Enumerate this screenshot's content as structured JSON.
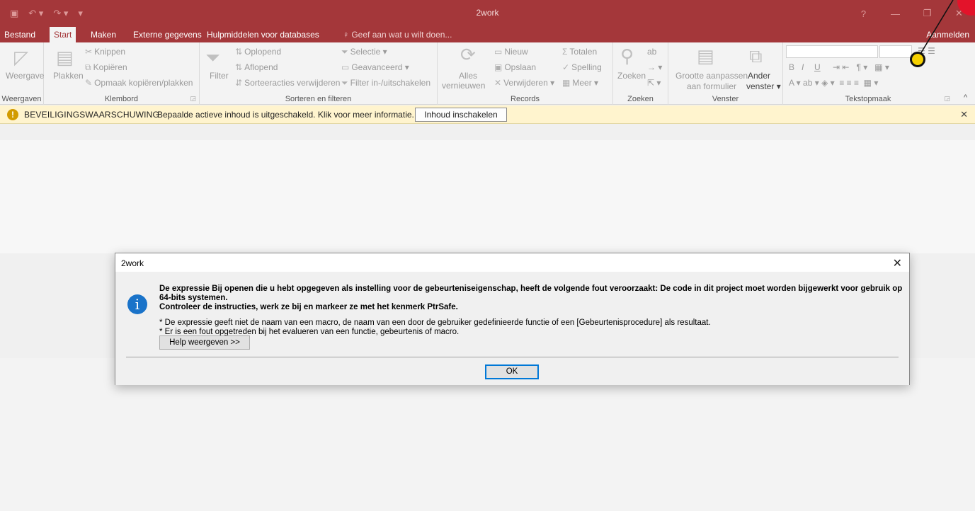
{
  "window": {
    "title": "2work"
  },
  "tabs": {
    "file": "Bestand",
    "start": "Start",
    "create": "Maken",
    "external": "Externe gegevens",
    "dbtools": "Hulpmiddelen voor databases",
    "tellme": "Geef aan wat u wilt doen...",
    "signin": "Aanmelden"
  },
  "ribbon": {
    "views": {
      "view": "Weergave",
      "label": "Weergaven"
    },
    "clipboard": {
      "paste": "Plakken",
      "cut": "Knippen",
      "copy": "Kopiëren",
      "format_painter": "Opmaak kopiëren/plakken",
      "label": "Klembord"
    },
    "sort": {
      "filter": "Filter",
      "ascending": "Oplopend",
      "descending": "Aflopend",
      "remove_sort": "Sorteeracties verwijderen",
      "selection": "Selectie",
      "advanced": "Geavanceerd",
      "toggle_filter": "Filter in-/uitschakelen",
      "label": "Sorteren en filteren"
    },
    "records": {
      "refresh_all_1": "Alles",
      "refresh_all_2": "vernieuwen",
      "new": "Nieuw",
      "save": "Opslaan",
      "delete": "Verwijderen",
      "totals": "Totalen",
      "spelling": "Spelling",
      "more": "Meer",
      "label": "Records"
    },
    "find": {
      "find": "Zoeken",
      "label": "Zoeken"
    },
    "window": {
      "fit_form_1": "Grootte aanpassen",
      "fit_form_2": "aan formulier",
      "switch_1": "Ander",
      "switch_2": "venster",
      "label": "Venster"
    },
    "text": {
      "bold": "B",
      "italic": "I",
      "underline": "U",
      "label": "Tekstopmaak"
    }
  },
  "warning": {
    "icon": "!",
    "title": "BEVEILIGINGSWAARSCHUWING",
    "message": "Bepaalde actieve inhoud is uitgeschakeld. Klik voor meer informatie.",
    "button": "Inhoud inschakelen"
  },
  "dialog": {
    "title": "2work",
    "icon": "i",
    "line1": "De expressie Bij openen die u hebt opgegeven als instelling voor de gebeurteniseigenschap, heeft de volgende fout veroorzaakt: De code in dit project moet worden bijgewerkt voor gebruik op 64-bits systemen.",
    "line2": "Controleer de instructies, werk ze bij en markeer ze met het kenmerk PtrSafe.",
    "bullet1": "* De expressie geeft niet de naam van een macro, de naam van een door de gebruiker gedefinieerde functie of een [Gebeurtenisprocedure] als resultaat.",
    "bullet2": "* Er is een fout opgetreden bij het evalueren van een functie, gebeurtenis of macro.",
    "help_button": "Help weergeven >>",
    "ok_button": "OK"
  }
}
